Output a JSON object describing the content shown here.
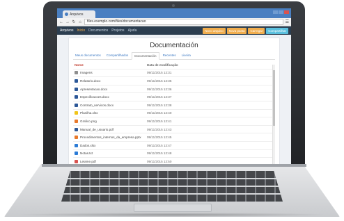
{
  "browser": {
    "tab_title": "Arquivos",
    "url": "files.exemplo.com/files/documentacao"
  },
  "app_nav": {
    "brand": "Arquivos",
    "links": [
      "Inicio",
      "Documentos",
      "Projetos",
      "Ajuda"
    ],
    "buttons": [
      {
        "label": "Novo arquivo",
        "color": "#f0ad4e"
      },
      {
        "label": "Nova pasta",
        "color": "#f0ad4e"
      },
      {
        "label": "Carregar",
        "color": "#f0ad4e"
      },
      {
        "label": "Compartilhar",
        "color": "#5bc0de"
      }
    ]
  },
  "main": {
    "title": "Documentación",
    "subtabs": [
      "Meus documentos",
      "Compartilhados",
      "Documentación",
      "Recentes",
      "Lixeira"
    ],
    "active_subtab": 2,
    "table": {
      "headers": {
        "name": "Nome",
        "date": "Data de modificação"
      },
      "rows": [
        {
          "name": "Imagens",
          "date": "09/11/2015 12:31",
          "icon": "folder-icon",
          "color": "#8e8e8e"
        },
        {
          "name": "Relatorio.docx",
          "date": "09/11/2015 12:35",
          "icon": "word-icon",
          "color": "#2b5797"
        },
        {
          "name": "Apresentacao.docx",
          "date": "09/11/2015 12:36",
          "icon": "word-icon",
          "color": "#2b5797"
        },
        {
          "name": "Especificacoes.docx",
          "date": "09/11/2015 12:37",
          "icon": "word-icon",
          "color": "#2b5797"
        },
        {
          "name": "Contrato_servicos.docx",
          "date": "09/11/2015 12:38",
          "icon": "word-icon",
          "color": "#2b5797"
        },
        {
          "name": "Planilha.xlsx",
          "date": "09/11/2015 12:40",
          "icon": "folder-icon",
          "color": "#f0c419"
        },
        {
          "name": "Grafico.png",
          "date": "09/11/2015 12:41",
          "icon": "image-icon",
          "color": "#e8792b"
        },
        {
          "name": "Manual_de_usuario.pdf",
          "date": "09/11/2015 12:43",
          "icon": "word-icon",
          "color": "#2b5797"
        },
        {
          "name": "Procedimentos_internos_da_empresa.pptx",
          "date": "09/11/2015 12:45",
          "icon": "slides-icon",
          "color": "#e8792b"
        },
        {
          "name": "Dados.xlsx",
          "date": "09/11/2015 12:47",
          "icon": "sheet-icon",
          "color": "#2b7bd6"
        },
        {
          "name": "Notas.txt",
          "date": "09/11/2015 12:48",
          "icon": "doc-icon",
          "color": "#2b7bd6"
        },
        {
          "name": "Leiame.pdf",
          "date": "09/11/2015 12:50",
          "icon": "pdf-icon",
          "color": "#d9534f"
        }
      ]
    }
  }
}
